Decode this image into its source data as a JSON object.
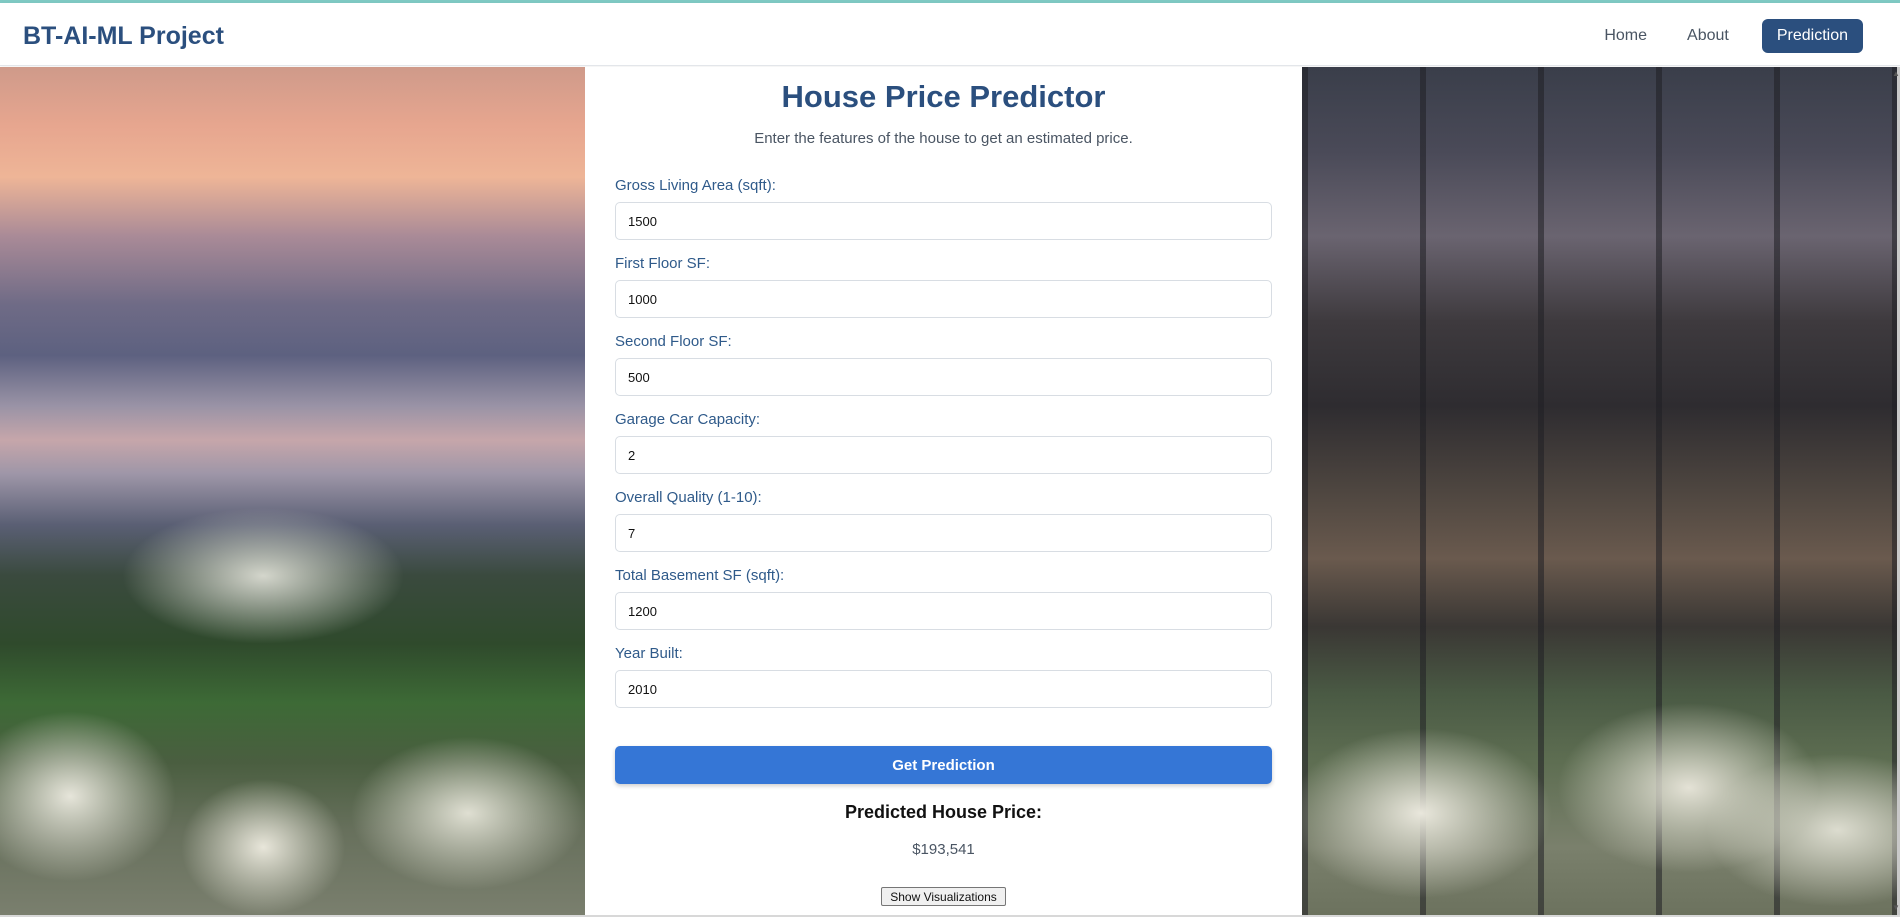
{
  "navbar": {
    "brand": "BT-AI-ML Project",
    "links": [
      {
        "label": "Home"
      },
      {
        "label": "About"
      },
      {
        "label": "Prediction"
      }
    ],
    "active_color": "#2b4f7e"
  },
  "form": {
    "title": "House Price Predictor",
    "subtitle": "Enter the features of the house to get an estimated price.",
    "fields": [
      {
        "label": "Gross Living Area (sqft):",
        "value": "1500"
      },
      {
        "label": "First Floor SF:",
        "value": "1000"
      },
      {
        "label": "Second Floor SF:",
        "value": "500"
      },
      {
        "label": "Garage Car Capacity:",
        "value": "2"
      },
      {
        "label": "Overall Quality (1-10):",
        "value": "7"
      },
      {
        "label": "Total Basement SF (sqft):",
        "value": "1200"
      },
      {
        "label": "Year Built:",
        "value": "2010"
      }
    ],
    "submit_label": "Get Prediction",
    "button_color": "#3576d6"
  },
  "result": {
    "label": "Predicted House Price:",
    "value": "$193,541"
  },
  "visualizations_button": "Show Visualizations",
  "background": {
    "left_image": "lake-sunset-hydrangea-photo",
    "right_image": "modern-glass-house-hydrangea-photo"
  }
}
